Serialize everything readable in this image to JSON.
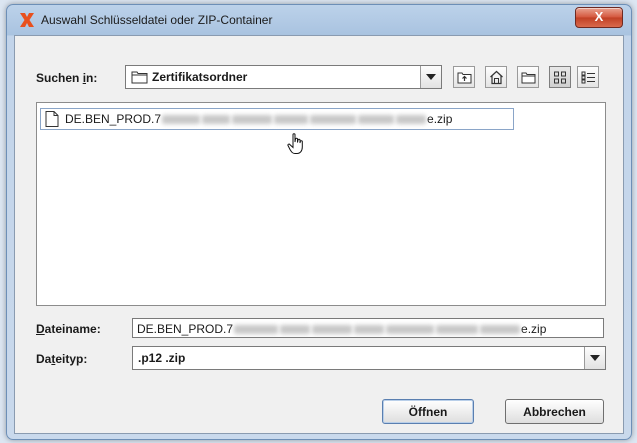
{
  "window": {
    "title": "Auswahl Schlüsseldatei oder ZIP-Container",
    "close_symbol": "X",
    "app_icon": "red-x-logo-icon"
  },
  "search": {
    "label_prefix": "Suchen ",
    "label_mnemonic": "i",
    "label_suffix": "n:",
    "folder_icon": "folder-icon",
    "selected_folder": "Zertifikatsordner"
  },
  "toolbar": {
    "buttons": [
      {
        "name": "up-one-level-icon"
      },
      {
        "name": "home-icon"
      },
      {
        "name": "new-folder-icon"
      },
      {
        "name": "list-view-icon",
        "active": true
      },
      {
        "name": "details-view-icon"
      }
    ]
  },
  "file_list": {
    "items": [
      {
        "icon": "file-icon",
        "name_visible_prefix": "DE.BEN_PROD.7",
        "name_visible_suffix": "e.zip",
        "selected": true
      }
    ]
  },
  "filename": {
    "label_mnemonic": "D",
    "label_rest": "ateiname:",
    "value_prefix": "DE.BEN_PROD.7",
    "value_suffix": "e.zip"
  },
  "filetype": {
    "label_start": "Da",
    "label_mnemonic": "t",
    "label_rest": "eityp:",
    "selected": ".p12 .zip"
  },
  "buttons": {
    "open": "Öffnen",
    "cancel": "Abbrechen"
  }
}
